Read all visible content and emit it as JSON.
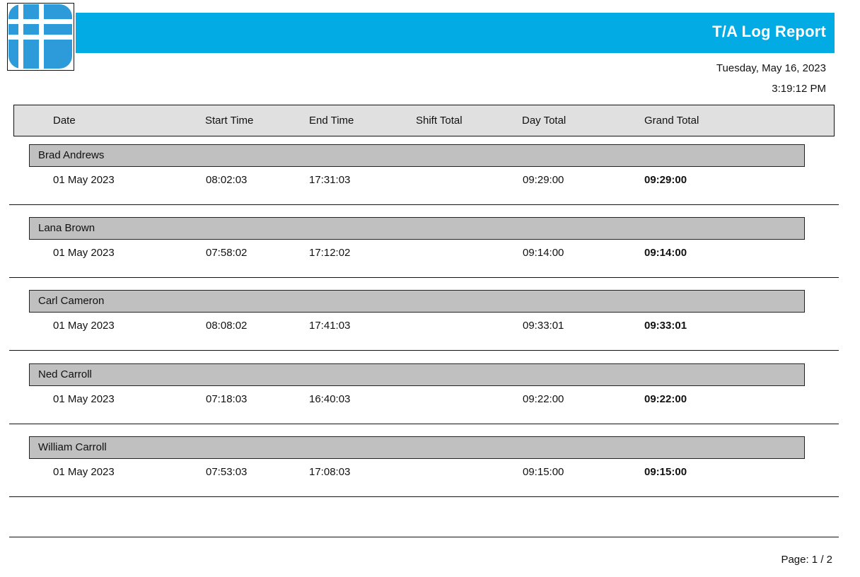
{
  "report": {
    "title": "T/A Log Report",
    "date": "Tuesday, May 16, 2023",
    "time": "3:19:12 PM"
  },
  "brand": {
    "banner_color": "#02abe3",
    "logo_color": "#2d9bd9",
    "logo_icon": "grid-logo-icon"
  },
  "columns": {
    "date": "Date",
    "start": "Start Time",
    "end": "End Time",
    "shift": "Shift Total",
    "day": "Day Total",
    "grand": "Grand Total"
  },
  "groups": [
    {
      "name": "Brad Andrews",
      "rows": [
        {
          "date": "01 May 2023",
          "start": "08:02:03",
          "end": "17:31:03",
          "shift": "",
          "day": "09:29:00",
          "grand": "09:29:00"
        }
      ]
    },
    {
      "name": "Lana Brown",
      "rows": [
        {
          "date": "01 May 2023",
          "start": "07:58:02",
          "end": "17:12:02",
          "shift": "",
          "day": "09:14:00",
          "grand": "09:14:00"
        }
      ]
    },
    {
      "name": "Carl Cameron",
      "rows": [
        {
          "date": "01 May 2023",
          "start": "08:08:02",
          "end": "17:41:03",
          "shift": "",
          "day": "09:33:01",
          "grand": "09:33:01"
        }
      ]
    },
    {
      "name": "Ned Carroll",
      "rows": [
        {
          "date": "01 May 2023",
          "start": "07:18:03",
          "end": "16:40:03",
          "shift": "",
          "day": "09:22:00",
          "grand": "09:22:00"
        }
      ]
    },
    {
      "name": "William Carroll",
      "rows": [
        {
          "date": "01 May 2023",
          "start": "07:53:03",
          "end": "17:08:03",
          "shift": "",
          "day": "09:15:00",
          "grand": "09:15:00"
        }
      ]
    }
  ],
  "footer": {
    "page": "Page: 1 / 2"
  }
}
